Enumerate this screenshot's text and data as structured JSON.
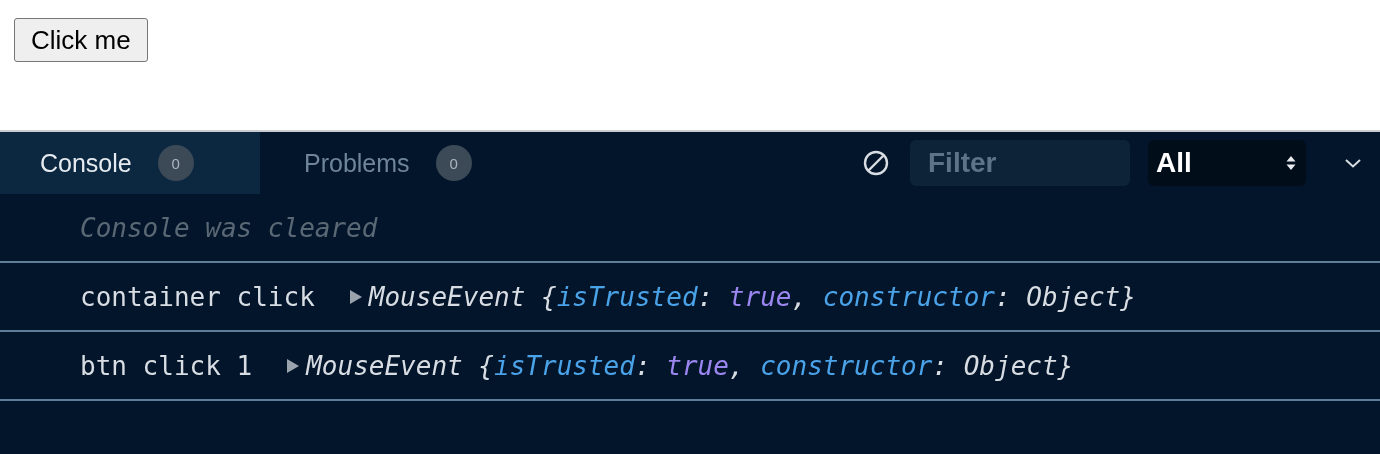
{
  "page": {
    "button": "Click me"
  },
  "console": {
    "tabs": [
      {
        "label": "Console",
        "count": "0",
        "selected": true
      },
      {
        "label": "Problems",
        "count": "0",
        "selected": false
      }
    ],
    "filter": {
      "placeholder": "Filter"
    },
    "level_select": {
      "value": "All"
    },
    "entries": [
      {
        "kind": "info",
        "text": "Console was cleared"
      },
      {
        "kind": "log",
        "text": "container click",
        "object": [
          {
            "kind": "plain",
            "text": "MouseEvent {"
          },
          {
            "kind": "key",
            "text": "isTrusted"
          },
          {
            "kind": "plain",
            "text": ": "
          },
          {
            "kind": "boolean",
            "text": "true"
          },
          {
            "kind": "plain",
            "text": ", "
          },
          {
            "kind": "key",
            "text": "constructor"
          },
          {
            "kind": "plain",
            "text": ": Object}"
          }
        ]
      },
      {
        "kind": "log",
        "text": "btn click 1",
        "object": [
          {
            "kind": "plain",
            "text": "MouseEvent {"
          },
          {
            "kind": "key",
            "text": "isTrusted"
          },
          {
            "kind": "plain",
            "text": ": "
          },
          {
            "kind": "boolean",
            "text": "true"
          },
          {
            "kind": "plain",
            "text": ", "
          },
          {
            "kind": "key",
            "text": "constructor"
          },
          {
            "kind": "plain",
            "text": ": Object}"
          }
        ]
      }
    ]
  }
}
